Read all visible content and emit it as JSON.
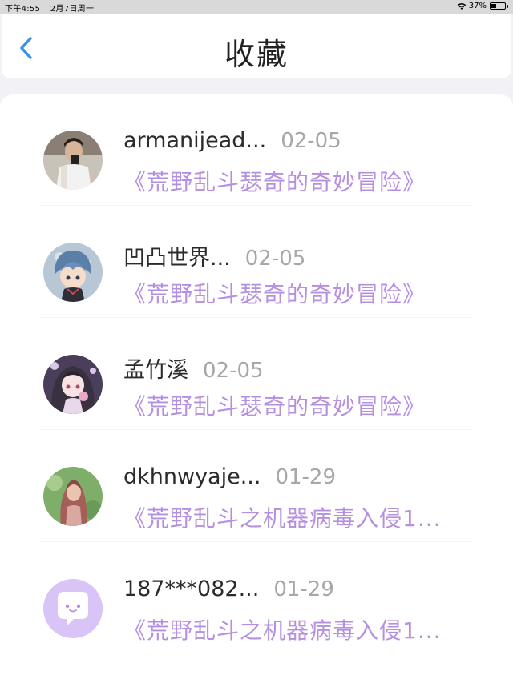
{
  "status_bar": {
    "time": "下午4:55",
    "date": "2月7日周一",
    "battery": "37%",
    "battery_level": 0.37
  },
  "header": {
    "title": "收藏",
    "back_icon": "chevron-left-icon"
  },
  "colors": {
    "accent": "#b58fe0",
    "back_icon": "#3a93e8",
    "name": "#2b2b2b",
    "date": "#a7a7a7"
  },
  "favorites": [
    {
      "username": "armanijead...",
      "date": "02-05",
      "title": "《荒野乱斗瑟奇的奇妙冒险》",
      "avatar": "user-photo"
    },
    {
      "username": "凹凸世界...",
      "date": "02-05",
      "title": "《荒野乱斗瑟奇的奇妙冒险》",
      "avatar": "anime-boy"
    },
    {
      "username": "孟竹溪",
      "date": "02-05",
      "title": "《荒野乱斗瑟奇的奇妙冒险》",
      "avatar": "anime-girl"
    },
    {
      "username": "dkhnwyaje...",
      "date": "01-29",
      "title": "《荒野乱斗之机器病毒入侵1...",
      "avatar": "user-photo"
    },
    {
      "username": "187***082...",
      "date": "01-29",
      "title": "《荒野乱斗之机器病毒入侵1...",
      "avatar": "default-chat-icon"
    }
  ]
}
